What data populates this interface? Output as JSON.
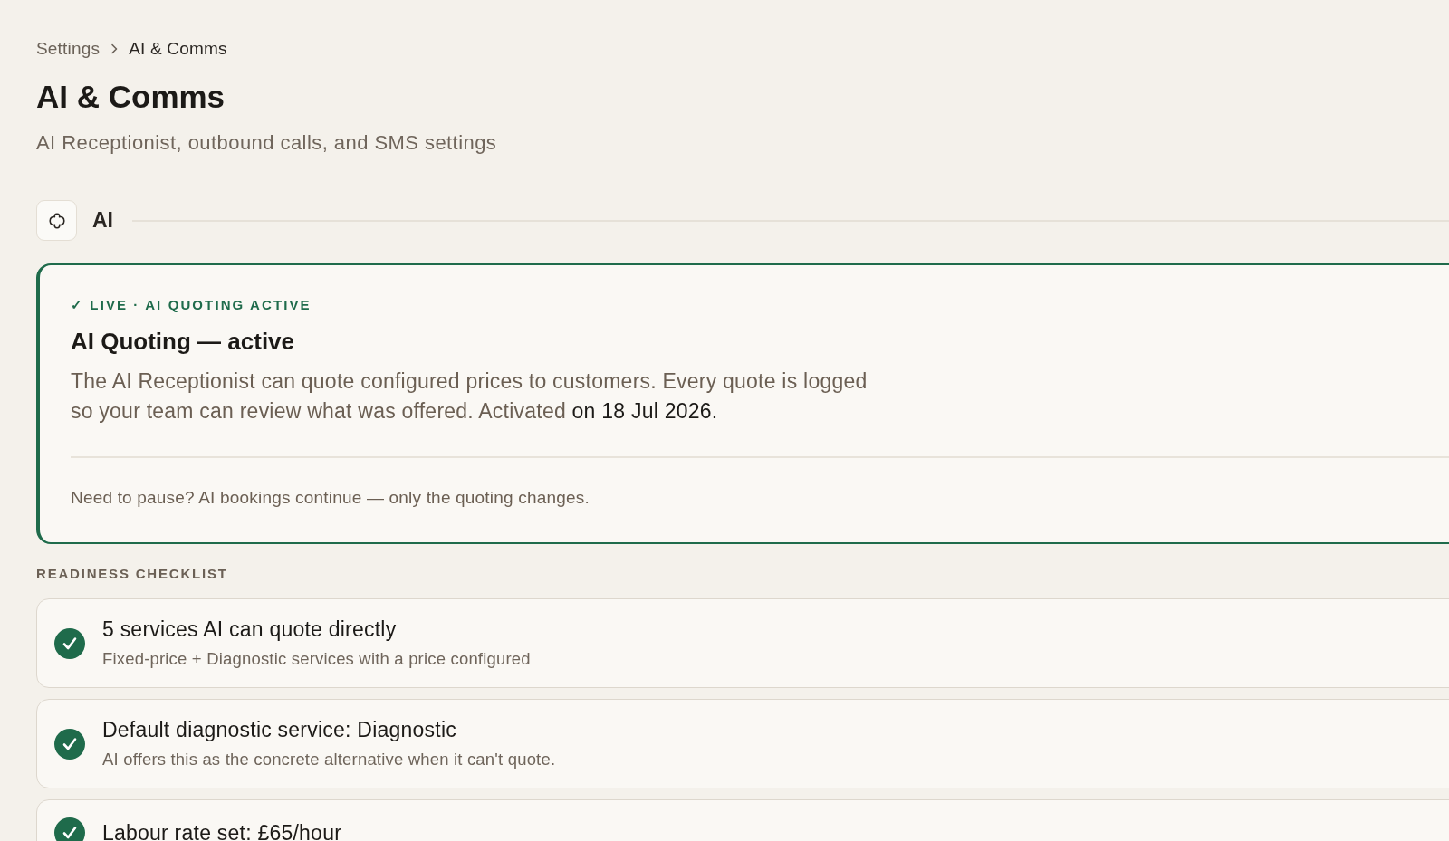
{
  "breadcrumb": [
    {
      "label": "Settings",
      "kind": "link"
    },
    {
      "label": "AI & Comms",
      "kind": "current"
    }
  ],
  "page": {
    "title": "AI & Comms",
    "subtitle": "AI Receptionist, outbound calls, and SMS settings"
  },
  "section": {
    "title": "AI"
  },
  "status_card": {
    "active": true,
    "label": "✓ LIVE · AI QUOTING ACTIVE",
    "heading": "AI Quoting — active",
    "body": "The AI Receptionist can quote configured prices to customers. Every quote is logged so your team can review what was offered. Activated",
    "activated_on": "on 18 Jul 2026.",
    "footer": "Need to pause? AI bookings continue — only the quoting changes."
  },
  "checklist": {
    "title": "READINESS CHECKLIST",
    "items": [
      {
        "title": "5 services AI can quote directly",
        "description": "Fixed-price + Diagnostic services with a price configured",
        "done": true
      },
      {
        "title": "Default diagnostic service: Diagnostic",
        "description": "AI offers this as the concrete alternative when it can't quote.",
        "done": true
      },
      {
        "title": "Labour rate set: £65/hour",
        "done": true
      }
    ]
  }
}
